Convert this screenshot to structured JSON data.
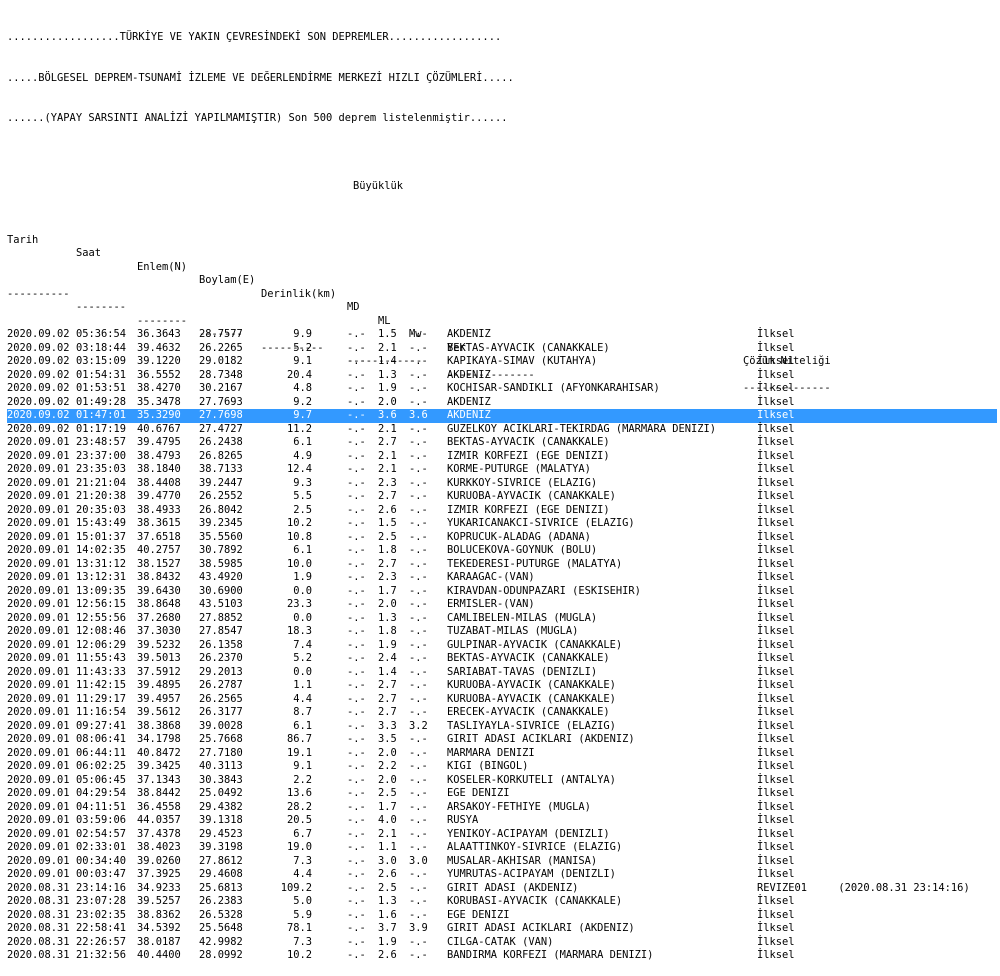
{
  "header": {
    "line1": "..................TÜRKİYE VE YAKIN ÇEVRESİNDEKİ SON DEPREMLER..................",
    "line2": ".....BÖLGESEL DEPREM-TSUNAMİ İZLEME VE DEĞERLENDİRME MERKEZİ HIZLI ÇÖZÜMLERİ.....",
    "line3": "......(YAPAY SARSINTI ANALİZİ YAPILMAMIŞTIR) Son 500 deprem listelenmiştir......"
  },
  "columns": {
    "magnitude_group": "Büyüklük",
    "date": "Tarih",
    "time": "Saat",
    "lat": "Enlem(N)",
    "lon": "Boylam(E)",
    "depth": "Derinlik(km)",
    "md": "MD",
    "ml": "ML",
    "mw": "Mw",
    "place": "Yer",
    "quality": "Çözüm Niteliği",
    "sep_date": "----------",
    "sep_time": "--------",
    "sep_lat": "--------",
    "sep_lon": "-------",
    "sep_depth": "----------",
    "sep_mag": "------------",
    "sep_place": "--------------",
    "sep_quality": "--------------"
  },
  "selected_index": 6,
  "rows": [
    [
      "2020.09.02",
      "05:36:54",
      "36.3643",
      "28.7577",
      "9.9",
      "-.-",
      "1.5",
      "-.-",
      "AKDENIZ",
      "İlksel"
    ],
    [
      "2020.09.02",
      "03:18:44",
      "39.4632",
      "26.2265",
      "5.2",
      "-.-",
      "2.1",
      "-.-",
      "BEKTAS-AYVACIK (CANAKKALE)",
      "İlksel"
    ],
    [
      "2020.09.02",
      "03:15:09",
      "39.1220",
      "29.0182",
      "9.1",
      "-.-",
      "1.4",
      "-.-",
      "KAPIKAYA-SIMAV (KUTAHYA)",
      "İlksel"
    ],
    [
      "2020.09.02",
      "01:54:31",
      "36.5552",
      "28.7348",
      "20.4",
      "-.-",
      "1.3",
      "-.-",
      "AKDENIZ",
      "İlksel"
    ],
    [
      "2020.09.02",
      "01:53:51",
      "38.4270",
      "30.2167",
      "4.8",
      "-.-",
      "1.9",
      "-.-",
      "KOCHISAR-SANDIKLI (AFYONKARAHISAR)",
      "İlksel"
    ],
    [
      "2020.09.02",
      "01:49:28",
      "35.3478",
      "27.7693",
      "9.2",
      "-.-",
      "2.0",
      "-.-",
      "AKDENIZ",
      "İlksel"
    ],
    [
      "2020.09.02",
      "01:47:01",
      "35.3290",
      "27.7698",
      "9.7",
      "-.-",
      "3.6",
      "3.6",
      "AKDENIZ",
      "İlksel"
    ],
    [
      "2020.09.02",
      "01:17:19",
      "40.6767",
      "27.4727",
      "11.2",
      "-.-",
      "2.1",
      "-.-",
      "GUZELKOY ACIKLARI-TEKIRDAG (MARMARA DENIZI)",
      "İlksel"
    ],
    [
      "2020.09.01",
      "23:48:57",
      "39.4795",
      "26.2438",
      "6.1",
      "-.-",
      "2.7",
      "-.-",
      "BEKTAS-AYVACIK (CANAKKALE)",
      "İlksel"
    ],
    [
      "2020.09.01",
      "23:37:00",
      "38.4793",
      "26.8265",
      "4.9",
      "-.-",
      "2.1",
      "-.-",
      "IZMIR KORFEZI (EGE DENIZI)",
      "İlksel"
    ],
    [
      "2020.09.01",
      "23:35:03",
      "38.1840",
      "38.7133",
      "12.4",
      "-.-",
      "2.1",
      "-.-",
      "KORME-PUTURGE (MALATYA)",
      "İlksel"
    ],
    [
      "2020.09.01",
      "21:21:04",
      "38.4408",
      "39.2447",
      "9.3",
      "-.-",
      "2.3",
      "-.-",
      "KURKKOY-SIVRICE (ELAZIG)",
      "İlksel"
    ],
    [
      "2020.09.01",
      "21:20:38",
      "39.4770",
      "26.2552",
      "5.5",
      "-.-",
      "2.7",
      "-.-",
      "KURUOBA-AYVACIK (CANAKKALE)",
      "İlksel"
    ],
    [
      "2020.09.01",
      "20:35:03",
      "38.4933",
      "26.8042",
      "2.5",
      "-.-",
      "2.6",
      "-.-",
      "IZMIR KORFEZI (EGE DENIZI)",
      "İlksel"
    ],
    [
      "2020.09.01",
      "15:43:49",
      "38.3615",
      "39.2345",
      "10.2",
      "-.-",
      "1.5",
      "-.-",
      "YUKARICANAKCI-SIVRICE (ELAZIG)",
      "İlksel"
    ],
    [
      "2020.09.01",
      "15:01:37",
      "37.6518",
      "35.5560",
      "10.8",
      "-.-",
      "2.5",
      "-.-",
      "KOPRUCUK-ALADAG (ADANA)",
      "İlksel"
    ],
    [
      "2020.09.01",
      "14:02:35",
      "40.2757",
      "30.7892",
      "6.1",
      "-.-",
      "1.8",
      "-.-",
      "BOLUCEKOVA-GOYNUK (BOLU)",
      "İlksel"
    ],
    [
      "2020.09.01",
      "13:31:12",
      "38.1527",
      "38.5985",
      "10.0",
      "-.-",
      "2.7",
      "-.-",
      "TEKEDERESI-PUTURGE (MALATYA)",
      "İlksel"
    ],
    [
      "2020.09.01",
      "13:12:31",
      "38.8432",
      "43.4920",
      "1.9",
      "-.-",
      "2.3",
      "-.-",
      "KARAAGAC-(VAN)",
      "İlksel"
    ],
    [
      "2020.09.01",
      "13:09:35",
      "39.6430",
      "30.6900",
      "0.0",
      "-.-",
      "1.7",
      "-.-",
      "KIRAVDAN-ODUNPAZARI (ESKISEHIR)",
      "İlksel"
    ],
    [
      "2020.09.01",
      "12:56:15",
      "38.8648",
      "43.5103",
      "23.3",
      "-.-",
      "2.0",
      "-.-",
      "ERMISLER-(VAN)",
      "İlksel"
    ],
    [
      "2020.09.01",
      "12:55:56",
      "37.2680",
      "27.8852",
      "0.0",
      "-.-",
      "1.3",
      "-.-",
      "CAMLIBELEN-MILAS (MUGLA)",
      "İlksel"
    ],
    [
      "2020.09.01",
      "12:08:46",
      "37.3030",
      "27.8547",
      "18.3",
      "-.-",
      "1.8",
      "-.-",
      "TUZABAT-MILAS (MUGLA)",
      "İlksel"
    ],
    [
      "2020.09.01",
      "12:06:29",
      "39.5232",
      "26.1358",
      "7.4",
      "-.-",
      "1.9",
      "-.-",
      "GULPINAR-AYVACIK (CANAKKALE)",
      "İlksel"
    ],
    [
      "2020.09.01",
      "11:55:43",
      "39.5013",
      "26.2370",
      "5.2",
      "-.-",
      "2.4",
      "-.-",
      "BEKTAS-AYVACIK (CANAKKALE)",
      "İlksel"
    ],
    [
      "2020.09.01",
      "11:43:33",
      "37.5912",
      "29.2013",
      "0.0",
      "-.-",
      "1.4",
      "-.-",
      "SARIABAT-TAVAS (DENIZLI)",
      "İlksel"
    ],
    [
      "2020.09.01",
      "11:42:15",
      "39.4895",
      "26.2787",
      "1.1",
      "-.-",
      "2.7",
      "-.-",
      "KURUOBA-AYVACIK (CANAKKALE)",
      "İlksel"
    ],
    [
      "2020.09.01",
      "11:29:17",
      "39.4957",
      "26.2565",
      "4.4",
      "-.-",
      "2.7",
      "-.-",
      "KURUOBA-AYVACIK (CANAKKALE)",
      "İlksel"
    ],
    [
      "2020.09.01",
      "11:16:54",
      "39.5612",
      "26.3177",
      "8.7",
      "-.-",
      "2.7",
      "-.-",
      "ERECEK-AYVACIK (CANAKKALE)",
      "İlksel"
    ],
    [
      "2020.09.01",
      "09:27:41",
      "38.3868",
      "39.0028",
      "6.1",
      "-.-",
      "3.3",
      "3.2",
      "TASLIYAYLA-SIVRICE (ELAZIG)",
      "İlksel"
    ],
    [
      "2020.09.01",
      "08:06:41",
      "34.1798",
      "25.7668",
      "86.7",
      "-.-",
      "3.5",
      "-.-",
      "GIRIT ADASI ACIKLARI (AKDENIZ)",
      "İlksel"
    ],
    [
      "2020.09.01",
      "06:44:11",
      "40.8472",
      "27.7180",
      "19.1",
      "-.-",
      "2.0",
      "-.-",
      "MARMARA DENIZI",
      "İlksel"
    ],
    [
      "2020.09.01",
      "06:02:25",
      "39.3425",
      "40.3113",
      "9.1",
      "-.-",
      "2.2",
      "-.-",
      "KIGI (BINGOL)",
      "İlksel"
    ],
    [
      "2020.09.01",
      "05:06:45",
      "37.1343",
      "30.3843",
      "2.2",
      "-.-",
      "2.0",
      "-.-",
      "KOSELER-KORKUTELI (ANTALYA)",
      "İlksel"
    ],
    [
      "2020.09.01",
      "04:29:54",
      "38.8442",
      "25.0492",
      "13.6",
      "-.-",
      "2.5",
      "-.-",
      "EGE DENIZI",
      "İlksel"
    ],
    [
      "2020.09.01",
      "04:11:51",
      "36.4558",
      "29.4382",
      "28.2",
      "-.-",
      "1.7",
      "-.-",
      "ARSAKOY-FETHIYE (MUGLA)",
      "İlksel"
    ],
    [
      "2020.09.01",
      "03:59:06",
      "44.0357",
      "39.1318",
      "20.5",
      "-.-",
      "4.0",
      "-.-",
      "RUSYA",
      "İlksel"
    ],
    [
      "2020.09.01",
      "02:54:57",
      "37.4378",
      "29.4523",
      "6.7",
      "-.-",
      "2.1",
      "-.-",
      "YENIKOY-ACIPAYAM (DENIZLI)",
      "İlksel"
    ],
    [
      "2020.09.01",
      "02:33:01",
      "38.4023",
      "39.3198",
      "19.0",
      "-.-",
      "1.1",
      "-.-",
      "ALAATTINKOY-SIVRICE (ELAZIG)",
      "İlksel"
    ],
    [
      "2020.09.01",
      "00:34:40",
      "39.0260",
      "27.8612",
      "7.3",
      "-.-",
      "3.0",
      "3.0",
      "MUSALAR-AKHISAR (MANISA)",
      "İlksel"
    ],
    [
      "2020.09.01",
      "00:03:47",
      "37.3925",
      "29.4608",
      "4.4",
      "-.-",
      "2.6",
      "-.-",
      "YUMRUTAS-ACIPAYAM (DENIZLI)",
      "İlksel"
    ],
    [
      "2020.08.31",
      "23:14:16",
      "34.9233",
      "25.6813",
      "109.2",
      "-.-",
      "2.5",
      "-.-",
      "GIRIT ADASI (AKDENIZ)",
      "REVIZE01     (2020.08.31 23:14:16)"
    ],
    [
      "2020.08.31",
      "23:07:28",
      "39.5257",
      "26.2383",
      "5.0",
      "-.-",
      "1.3",
      "-.-",
      "KORUBASI-AYVACIK (CANAKKALE)",
      "İlksel"
    ],
    [
      "2020.08.31",
      "23:02:35",
      "38.8362",
      "26.5328",
      "5.9",
      "-.-",
      "1.6",
      "-.-",
      "EGE DENIZI",
      "İlksel"
    ],
    [
      "2020.08.31",
      "22:58:41",
      "34.5392",
      "25.5648",
      "78.1",
      "-.-",
      "3.7",
      "3.9",
      "GIRIT ADASI ACIKLARI (AKDENIZ)",
      "İlksel"
    ],
    [
      "2020.08.31",
      "22:26:57",
      "38.0187",
      "42.9982",
      "7.3",
      "-.-",
      "1.9",
      "-.-",
      "CILGA-CATAK (VAN)",
      "İlksel"
    ],
    [
      "2020.08.31",
      "21:32:56",
      "40.4400",
      "28.0992",
      "10.2",
      "-.-",
      "2.6",
      "-.-",
      "BANDIRMA KORFEZI (MARMARA DENIZI)",
      "İlksel"
    ]
  ]
}
